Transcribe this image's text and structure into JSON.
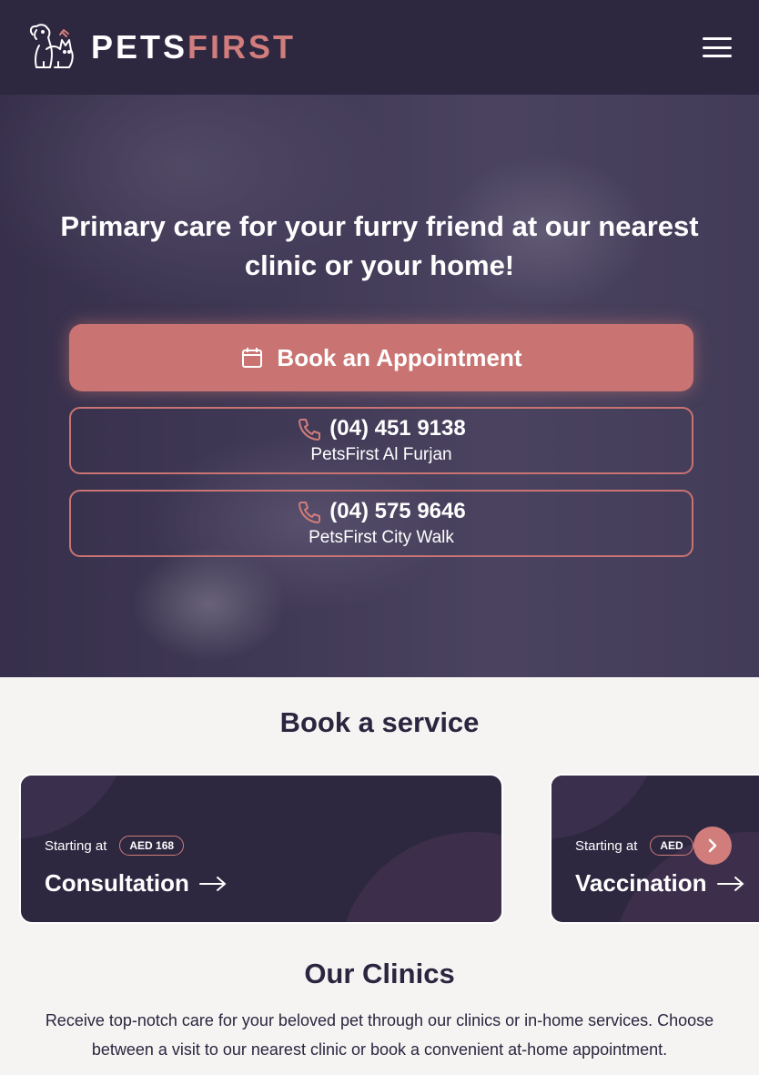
{
  "header": {
    "brand_part1": "PETS",
    "brand_part2": "FIRST",
    "logo_icon": "dog-cat-logo-icon",
    "menu_icon": "hamburger-menu-icon"
  },
  "hero": {
    "title": "Primary care for your furry friend at our nearest clinic or your home!",
    "book_button": "Book an Appointment",
    "phones": [
      {
        "number": "(04) 451 9138",
        "location": "PetsFirst Al Furjan"
      },
      {
        "number": "(04) 575 9646",
        "location": "PetsFirst City Walk"
      }
    ]
  },
  "services": {
    "title": "Book a service",
    "items": [
      {
        "starting_label": "Starting at",
        "price": "AED 168",
        "name": "Consultation"
      },
      {
        "starting_label": "Starting at",
        "price": "AED",
        "name": "Vaccination"
      }
    ]
  },
  "clinics": {
    "title": "Our Clinics",
    "description": "Receive top-notch care for your beloved pet through our clinics or in-home services. Choose between a visit to our nearest clinic or book a convenient at-home appointment."
  },
  "colors": {
    "header_bg": "#2d2740",
    "accent": "#c97472",
    "page_bg": "#f6f4f2"
  }
}
